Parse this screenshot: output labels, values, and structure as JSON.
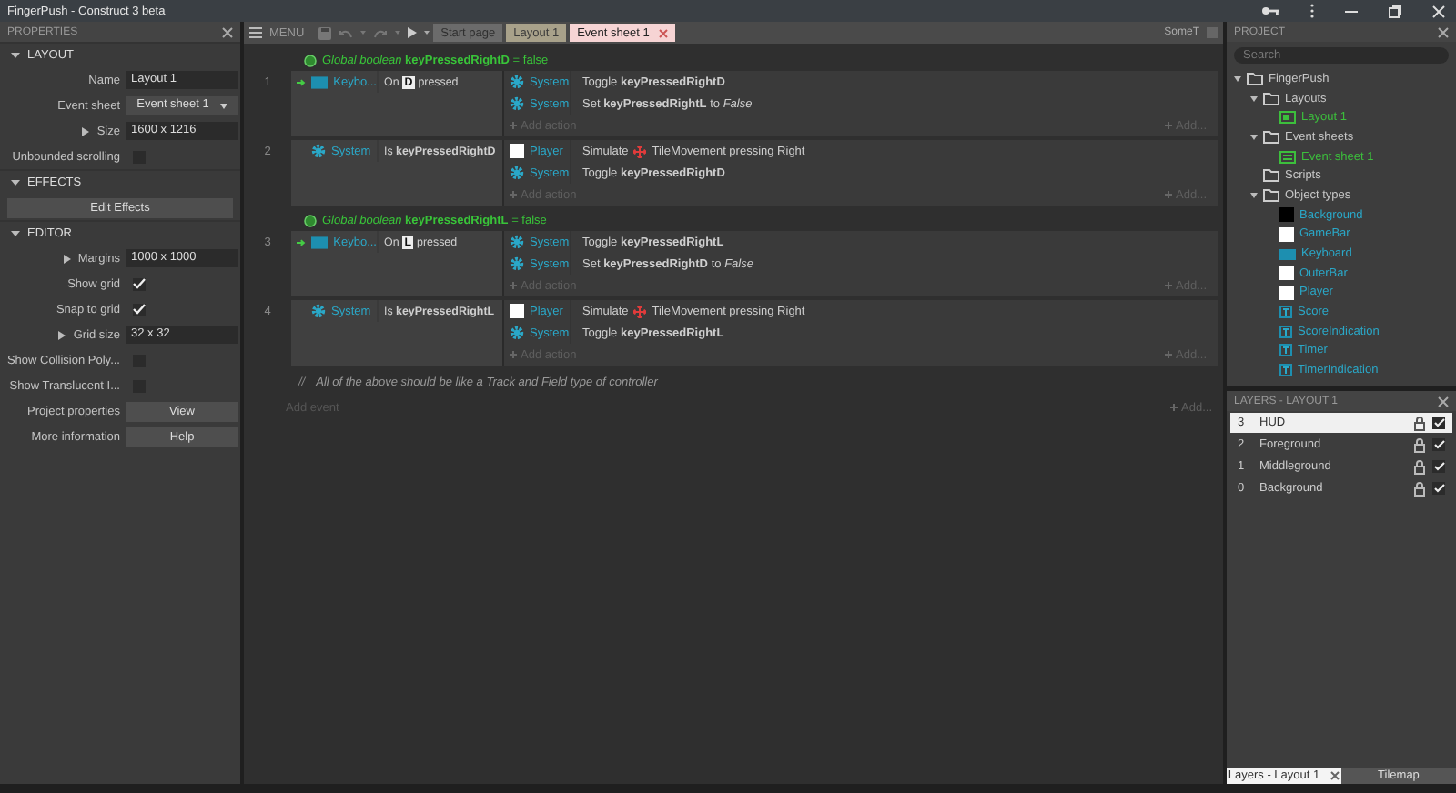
{
  "window": {
    "title": "FingerPush - Construct 3 beta"
  },
  "properties": {
    "title": "PROPERTIES",
    "sections": [
      {
        "title": "LAYOUT",
        "expanded": true,
        "rows": [
          {
            "kind": "text",
            "label": "Name",
            "value": "Layout 1"
          },
          {
            "kind": "select",
            "label": "Event sheet",
            "value": "Event sheet 1"
          },
          {
            "kind": "text",
            "label": "Size",
            "value": "1600 x 1216",
            "expanded": false
          },
          {
            "kind": "check",
            "label": "Unbounded scrolling",
            "checked": false
          }
        ]
      },
      {
        "title": "EFFECTS",
        "expanded": true,
        "rows": [
          {
            "kind": "button",
            "value": "Edit Effects"
          }
        ]
      },
      {
        "title": "EDITOR",
        "expanded": true,
        "rows": [
          {
            "kind": "text",
            "label": "Margins",
            "value": "1000 x 1000",
            "expanded": false
          },
          {
            "kind": "check",
            "label": "Show grid",
            "checked": true
          },
          {
            "kind": "check",
            "label": "Snap to grid",
            "checked": true
          },
          {
            "kind": "text",
            "label": "Grid size",
            "value": "32 x 32",
            "expanded": false
          },
          {
            "kind": "check",
            "label": "Show Collision Poly...",
            "checked": false
          },
          {
            "kind": "check",
            "label": "Show Translucent I...",
            "checked": false
          },
          {
            "kind": "button",
            "label": "Project properties",
            "value": "View"
          },
          {
            "kind": "button",
            "label": "More information",
            "value": "Help"
          }
        ]
      }
    ]
  },
  "toolbar": {
    "menu": "MENU",
    "tabs": [
      {
        "label": "Start page",
        "selected": false,
        "kind": "start"
      },
      {
        "label": "Layout 1",
        "selected": false,
        "kind": "layout"
      },
      {
        "label": "Event sheet 1",
        "selected": true,
        "kind": "events"
      }
    ],
    "right_label": "SomeT"
  },
  "events": {
    "items": [
      {
        "kind": "variable",
        "text": "*Global boolean* **keyPressedRightD** = false"
      },
      {
        "kind": "event",
        "number": "1",
        "trigger": true,
        "condition": {
          "object": "Keybo...",
          "kind": "keyboard",
          "before": "On",
          "key": "D",
          "after": "pressed"
        },
        "actions": [
          {
            "object": "System",
            "kind": "system",
            "text": "Toggle **keyPressedRightD**"
          },
          {
            "object": "System",
            "kind": "system",
            "text": "Set **keyPressedRightL** to *False*"
          }
        ],
        "add_action": "Add action",
        "add_more": "Add..."
      },
      {
        "kind": "event",
        "number": "2",
        "trigger": false,
        "condition": {
          "object": "System",
          "kind": "system",
          "text": "Is **keyPressedRightD**"
        },
        "actions": [
          {
            "object": "Player",
            "kind": "sprite",
            "text": "Simulate",
            "behavior": "TileMovement pressing Right"
          },
          {
            "object": "System",
            "kind": "system",
            "text": "Toggle **keyPressedRightD**"
          }
        ],
        "add_action": "Add action",
        "add_more": "Add..."
      },
      {
        "kind": "variable",
        "text": "*Global boolean* **keyPressedRightL** = false"
      },
      {
        "kind": "event",
        "number": "3",
        "trigger": true,
        "condition": {
          "object": "Keybo...",
          "kind": "keyboard",
          "before": "On",
          "key": "L",
          "after": "pressed"
        },
        "actions": [
          {
            "object": "System",
            "kind": "system",
            "text": "Toggle **keyPressedRightL**"
          },
          {
            "object": "System",
            "kind": "system",
            "text": "Set **keyPressedRightD** to *False*"
          }
        ],
        "add_action": "Add action",
        "add_more": "Add..."
      },
      {
        "kind": "event",
        "number": "4",
        "trigger": false,
        "condition": {
          "object": "System",
          "kind": "system",
          "text": "Is **keyPressedRightL**"
        },
        "actions": [
          {
            "object": "Player",
            "kind": "sprite",
            "text": "Simulate",
            "behavior": "TileMovement pressing Right"
          },
          {
            "object": "System",
            "kind": "system",
            "text": "Toggle **keyPressedRightL**"
          }
        ],
        "add_action": "Add action",
        "add_more": "Add..."
      },
      {
        "kind": "comment",
        "marker": "//",
        "text": "All of the above should be like a Track and Field type of controller"
      },
      {
        "kind": "add-event",
        "text": "Add event",
        "add_more": "Add..."
      }
    ]
  },
  "project": {
    "title": "PROJECT",
    "search": {
      "placeholder": "Search"
    },
    "tree": [
      {
        "label": "FingerPush",
        "kind": "folder",
        "children": [
          {
            "label": "Layouts",
            "kind": "folder",
            "children": [
              {
                "label": "Layout 1",
                "kind": "layout"
              }
            ]
          },
          {
            "label": "Event sheets",
            "kind": "folder",
            "children": [
              {
                "label": "Event sheet 1",
                "kind": "eventsheet"
              }
            ]
          },
          {
            "label": "Scripts",
            "kind": "folder"
          },
          {
            "label": "Object types",
            "kind": "folder",
            "children": [
              {
                "label": "Background",
                "kind": "sprite",
                "color": "#000000"
              },
              {
                "label": "GameBar",
                "kind": "sprite",
                "color": "#ffffff"
              },
              {
                "label": "Keyboard",
                "kind": "keyboard"
              },
              {
                "label": "OuterBar",
                "kind": "sprite",
                "color": "#ffffff"
              },
              {
                "label": "Player",
                "kind": "sprite",
                "color": "#ffffff"
              },
              {
                "label": "Score",
                "kind": "text"
              },
              {
                "label": "ScoreIndication",
                "kind": "text"
              },
              {
                "label": "Timer",
                "kind": "text"
              },
              {
                "label": "TimerIndication",
                "kind": "text"
              }
            ]
          }
        ]
      }
    ]
  },
  "layers": {
    "title": "LAYERS - LAYOUT 1",
    "items": [
      {
        "number": "3",
        "name": "HUD",
        "selected": true,
        "visible": true
      },
      {
        "number": "2",
        "name": "Foreground",
        "selected": false,
        "visible": true
      },
      {
        "number": "1",
        "name": "Middleground",
        "selected": false,
        "visible": true
      },
      {
        "number": "0",
        "name": "Background",
        "selected": false,
        "visible": true
      }
    ]
  },
  "bottom_tabs": [
    {
      "label": "Layers - Layout 1",
      "selected": true
    },
    {
      "label": "Tilemap",
      "selected": false
    }
  ]
}
